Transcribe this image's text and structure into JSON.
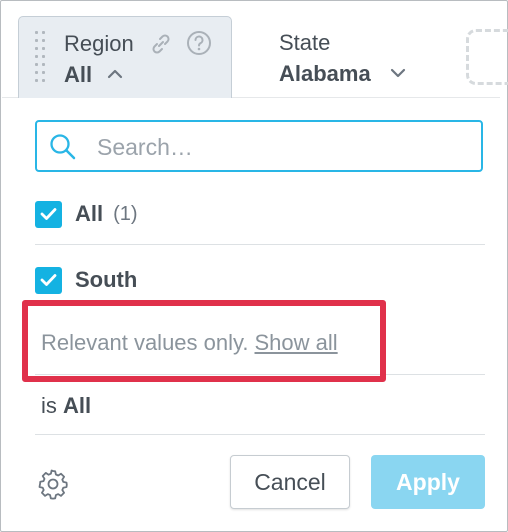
{
  "filters": {
    "region": {
      "title": "Region",
      "value": "All",
      "icons": [
        "link-icon",
        "help-icon",
        "chevron-up-icon"
      ]
    },
    "state": {
      "title": "State",
      "value": "Alabama",
      "icons": [
        "chevron-down-icon"
      ]
    }
  },
  "dropdown": {
    "search": {
      "placeholder": "Search…",
      "value": ""
    },
    "items": [
      {
        "label": "All",
        "count": "(1)",
        "checked": true
      },
      {
        "label": "South",
        "count": "",
        "checked": true
      }
    ],
    "relevant_note": "Relevant values only.",
    "show_all_link": "Show all",
    "summary_prefix": "is",
    "summary_value": "All",
    "buttons": {
      "cancel": "Cancel",
      "apply": "Apply"
    }
  },
  "colors": {
    "accent": "#14b2e2",
    "search_border": "#29b6e6",
    "apply_disabled": "#8ad6f1",
    "highlight": "#e0314b",
    "chip_active_bg": "#e8edf2"
  }
}
